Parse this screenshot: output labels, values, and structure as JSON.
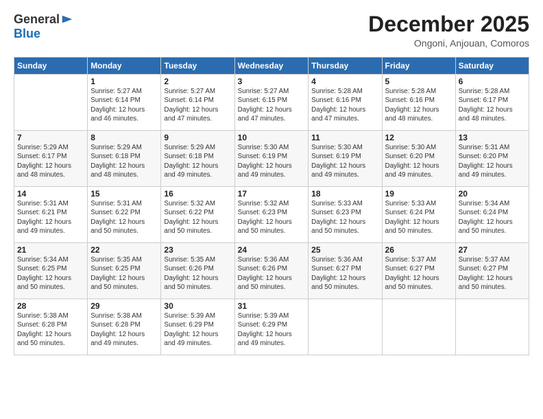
{
  "logo": {
    "general": "General",
    "blue": "Blue"
  },
  "header": {
    "month": "December 2025",
    "location": "Ongoni, Anjouan, Comoros"
  },
  "weekdays": [
    "Sunday",
    "Monday",
    "Tuesday",
    "Wednesday",
    "Thursday",
    "Friday",
    "Saturday"
  ],
  "weeks": [
    [
      {
        "day": "",
        "info": ""
      },
      {
        "day": "1",
        "info": "Sunrise: 5:27 AM\nSunset: 6:14 PM\nDaylight: 12 hours\nand 46 minutes."
      },
      {
        "day": "2",
        "info": "Sunrise: 5:27 AM\nSunset: 6:14 PM\nDaylight: 12 hours\nand 47 minutes."
      },
      {
        "day": "3",
        "info": "Sunrise: 5:27 AM\nSunset: 6:15 PM\nDaylight: 12 hours\nand 47 minutes."
      },
      {
        "day": "4",
        "info": "Sunrise: 5:28 AM\nSunset: 6:16 PM\nDaylight: 12 hours\nand 47 minutes."
      },
      {
        "day": "5",
        "info": "Sunrise: 5:28 AM\nSunset: 6:16 PM\nDaylight: 12 hours\nand 48 minutes."
      },
      {
        "day": "6",
        "info": "Sunrise: 5:28 AM\nSunset: 6:17 PM\nDaylight: 12 hours\nand 48 minutes."
      }
    ],
    [
      {
        "day": "7",
        "info": "Sunrise: 5:29 AM\nSunset: 6:17 PM\nDaylight: 12 hours\nand 48 minutes."
      },
      {
        "day": "8",
        "info": "Sunrise: 5:29 AM\nSunset: 6:18 PM\nDaylight: 12 hours\nand 48 minutes."
      },
      {
        "day": "9",
        "info": "Sunrise: 5:29 AM\nSunset: 6:18 PM\nDaylight: 12 hours\nand 49 minutes."
      },
      {
        "day": "10",
        "info": "Sunrise: 5:30 AM\nSunset: 6:19 PM\nDaylight: 12 hours\nand 49 minutes."
      },
      {
        "day": "11",
        "info": "Sunrise: 5:30 AM\nSunset: 6:19 PM\nDaylight: 12 hours\nand 49 minutes."
      },
      {
        "day": "12",
        "info": "Sunrise: 5:30 AM\nSunset: 6:20 PM\nDaylight: 12 hours\nand 49 minutes."
      },
      {
        "day": "13",
        "info": "Sunrise: 5:31 AM\nSunset: 6:20 PM\nDaylight: 12 hours\nand 49 minutes."
      }
    ],
    [
      {
        "day": "14",
        "info": "Sunrise: 5:31 AM\nSunset: 6:21 PM\nDaylight: 12 hours\nand 49 minutes."
      },
      {
        "day": "15",
        "info": "Sunrise: 5:31 AM\nSunset: 6:22 PM\nDaylight: 12 hours\nand 50 minutes."
      },
      {
        "day": "16",
        "info": "Sunrise: 5:32 AM\nSunset: 6:22 PM\nDaylight: 12 hours\nand 50 minutes."
      },
      {
        "day": "17",
        "info": "Sunrise: 5:32 AM\nSunset: 6:23 PM\nDaylight: 12 hours\nand 50 minutes."
      },
      {
        "day": "18",
        "info": "Sunrise: 5:33 AM\nSunset: 6:23 PM\nDaylight: 12 hours\nand 50 minutes."
      },
      {
        "day": "19",
        "info": "Sunrise: 5:33 AM\nSunset: 6:24 PM\nDaylight: 12 hours\nand 50 minutes."
      },
      {
        "day": "20",
        "info": "Sunrise: 5:34 AM\nSunset: 6:24 PM\nDaylight: 12 hours\nand 50 minutes."
      }
    ],
    [
      {
        "day": "21",
        "info": "Sunrise: 5:34 AM\nSunset: 6:25 PM\nDaylight: 12 hours\nand 50 minutes."
      },
      {
        "day": "22",
        "info": "Sunrise: 5:35 AM\nSunset: 6:25 PM\nDaylight: 12 hours\nand 50 minutes."
      },
      {
        "day": "23",
        "info": "Sunrise: 5:35 AM\nSunset: 6:26 PM\nDaylight: 12 hours\nand 50 minutes."
      },
      {
        "day": "24",
        "info": "Sunrise: 5:36 AM\nSunset: 6:26 PM\nDaylight: 12 hours\nand 50 minutes."
      },
      {
        "day": "25",
        "info": "Sunrise: 5:36 AM\nSunset: 6:27 PM\nDaylight: 12 hours\nand 50 minutes."
      },
      {
        "day": "26",
        "info": "Sunrise: 5:37 AM\nSunset: 6:27 PM\nDaylight: 12 hours\nand 50 minutes."
      },
      {
        "day": "27",
        "info": "Sunrise: 5:37 AM\nSunset: 6:27 PM\nDaylight: 12 hours\nand 50 minutes."
      }
    ],
    [
      {
        "day": "28",
        "info": "Sunrise: 5:38 AM\nSunset: 6:28 PM\nDaylight: 12 hours\nand 50 minutes."
      },
      {
        "day": "29",
        "info": "Sunrise: 5:38 AM\nSunset: 6:28 PM\nDaylight: 12 hours\nand 49 minutes."
      },
      {
        "day": "30",
        "info": "Sunrise: 5:39 AM\nSunset: 6:29 PM\nDaylight: 12 hours\nand 49 minutes."
      },
      {
        "day": "31",
        "info": "Sunrise: 5:39 AM\nSunset: 6:29 PM\nDaylight: 12 hours\nand 49 minutes."
      },
      {
        "day": "",
        "info": ""
      },
      {
        "day": "",
        "info": ""
      },
      {
        "day": "",
        "info": ""
      }
    ]
  ]
}
